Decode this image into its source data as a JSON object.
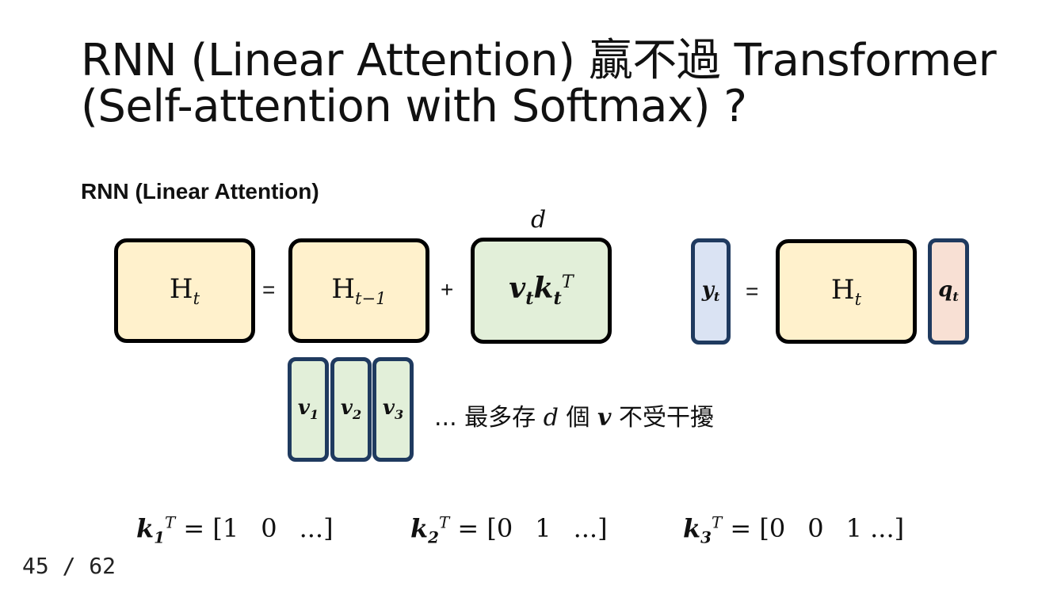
{
  "title": {
    "line1": "RNN (Linear Attention) 贏不過 Transformer",
    "line2": "(Self-attention with Softmax) ?"
  },
  "subtitle": "RNN (Linear Attention)",
  "equation1": {
    "lhs": "H",
    "lhs_sub": "t",
    "eq": "=",
    "prev": "H",
    "prev_sub": "t−1",
    "plus": "+",
    "update_v": "v",
    "update_v_sub": "t",
    "update_k": "k",
    "update_k_sub": "t",
    "update_k_sup": "T",
    "dim_label": "d"
  },
  "equation2": {
    "y": "y",
    "y_sub": "t",
    "eq": "=",
    "h": "H",
    "h_sub": "t",
    "q": "q",
    "q_sub": "t"
  },
  "vectors": [
    {
      "sym": "v",
      "sub": "1"
    },
    {
      "sym": "v",
      "sub": "2"
    },
    {
      "sym": "v",
      "sub": "3"
    }
  ],
  "note": {
    "prefix": "... 最多存",
    "d": "d",
    "mid": "個",
    "v": "v",
    "suffix": "不受干擾"
  },
  "key_equations": [
    {
      "sym": "k",
      "sub": "1",
      "sup": "T",
      "rhs_open": "= [1",
      "a": "0",
      "b": "...]"
    },
    {
      "sym": "k",
      "sub": "2",
      "sup": "T",
      "rhs_open": "= [0",
      "a": "1",
      "b": "...]"
    },
    {
      "sym": "k",
      "sub": "3",
      "sup": "T",
      "rhs_open": "= [0",
      "a": "0",
      "b": "1 ...]"
    }
  ],
  "page_number": "45 / 62",
  "colors": {
    "state_fill": "#fff1cc",
    "update_fill": "#e2efd9",
    "output_fill": "#dae3f3",
    "query_fill": "#f8e0d4",
    "vector_border": "#1f3a5f"
  }
}
